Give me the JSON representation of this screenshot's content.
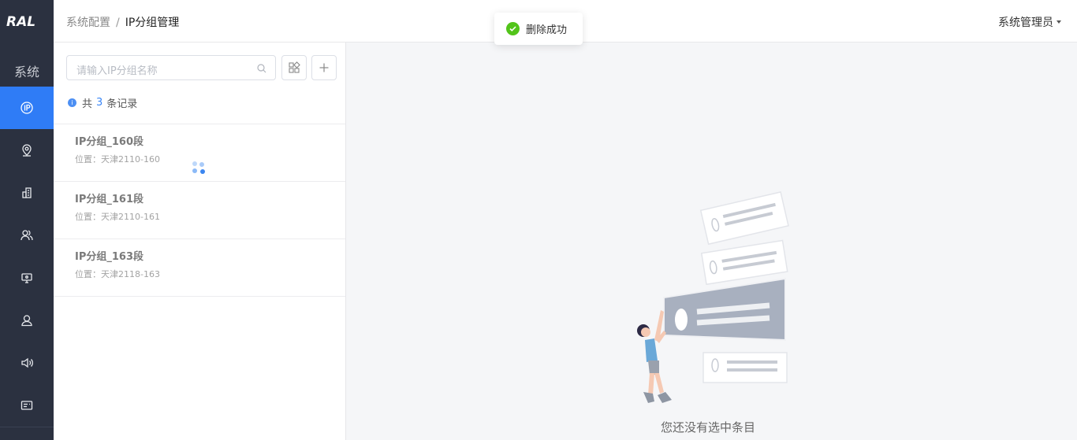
{
  "brand": {
    "logo_text": "RAL"
  },
  "nav": {
    "section_label": "系统",
    "items": [
      {
        "icon": "ip-icon",
        "active": true
      },
      {
        "icon": "location-pin-icon",
        "active": false
      },
      {
        "icon": "building-icon",
        "active": false
      },
      {
        "icon": "users-icon",
        "active": false
      },
      {
        "icon": "device-monitor-icon",
        "active": false
      },
      {
        "icon": "user-icon",
        "active": false
      },
      {
        "icon": "speaker-icon",
        "active": false
      },
      {
        "icon": "id-card-icon",
        "active": false
      }
    ]
  },
  "header": {
    "breadcrumb": [
      "系统配置",
      "IP分组管理"
    ],
    "separator": "/",
    "user": "系统管理员"
  },
  "toast": {
    "message": "删除成功",
    "status_color": "#52c41a"
  },
  "panel": {
    "search_placeholder": "请输入IP分组名称",
    "count_prefix": "共",
    "count_value": "3",
    "count_suffix": "条记录",
    "items": [
      {
        "name": "IP分组_160段",
        "location": "位置：天津2110-160"
      },
      {
        "name": "IP分组_161段",
        "location": "位置：天津2110-161"
      },
      {
        "name": "IP分组_163段",
        "location": "位置：天津2118-163"
      }
    ]
  },
  "main": {
    "empty_text": "您还没有选中条目"
  },
  "colors": {
    "accent": "#2f7cf6",
    "rail": "#2b3140"
  }
}
